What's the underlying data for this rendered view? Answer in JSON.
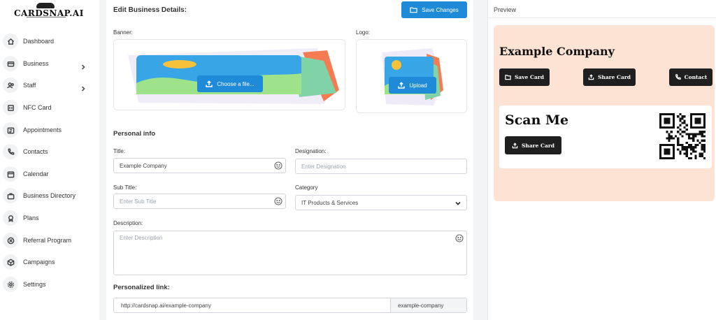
{
  "brand": {
    "name": "CARDSNAP.AI"
  },
  "sidebar": {
    "items": [
      {
        "label": "Dashboard",
        "icon": "home-icon"
      },
      {
        "label": "Business",
        "icon": "wallet-icon",
        "has_submenu": true
      },
      {
        "label": "Staff",
        "icon": "users-icon",
        "has_submenu": true
      },
      {
        "label": "NFC Card",
        "icon": "nfc-icon"
      },
      {
        "label": "Appointments",
        "icon": "calendar-check-icon"
      },
      {
        "label": "Contacts",
        "icon": "phone-icon"
      },
      {
        "label": "Calendar",
        "icon": "calendar-icon"
      },
      {
        "label": "Business Directory",
        "icon": "briefcase-icon"
      },
      {
        "label": "Plans",
        "icon": "award-icon"
      },
      {
        "label": "Referral Program",
        "icon": "share-circle-icon"
      },
      {
        "label": "Campaigns",
        "icon": "box-icon"
      },
      {
        "label": "Settings",
        "icon": "gear-icon"
      }
    ]
  },
  "editor": {
    "heading": "Edit Business Details:",
    "save_label": "Save Changes",
    "banner_label": "Banner:",
    "logo_label": "Logo:",
    "choose_file_label": "Choose a file...",
    "upload_label": "Upload",
    "personal_info_heading": "Personal info",
    "title_label": "Title:",
    "title_value": "Example Company",
    "designation_label": "Designation:",
    "designation_placeholder": "Enter Designation",
    "subtitle_label": "Sub Title:",
    "subtitle_placeholder": "Enter Sub Title",
    "category_label": "Category",
    "category_value": "IT Products & Services",
    "description_label": "Description:",
    "description_placeholder": "Enter Description",
    "personalized_link_label": "Personalized link:",
    "link_url": "http://cardsnap.ai/example-company",
    "link_slug": "example-company"
  },
  "preview": {
    "heading": "Preview",
    "company_name": "Example Company",
    "save_card_label": "Save Card",
    "share_card_label": "Share Card",
    "contact_label": "Contact",
    "scan_title": "Scan Me",
    "scan_share_label": "Share Card",
    "card_bg": "#fde3d4"
  },
  "colors": {
    "accent": "#1f8bd8",
    "dark_button": "#1f1f1f"
  }
}
